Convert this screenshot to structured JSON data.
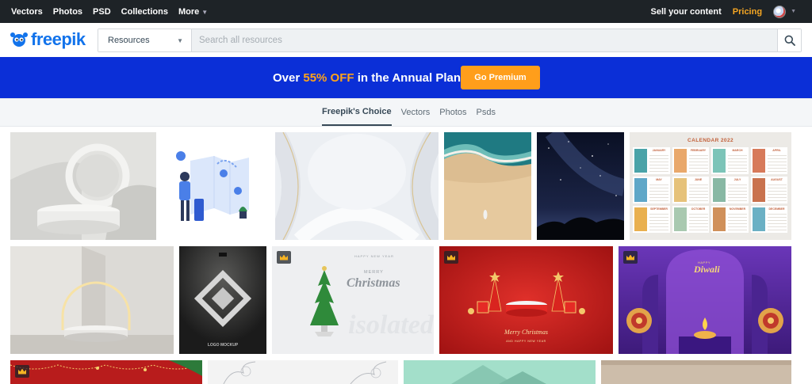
{
  "topbar": {
    "nav": [
      "Vectors",
      "Photos",
      "PSD",
      "Collections",
      "More"
    ],
    "sell": "Sell your content",
    "pricing": "Pricing"
  },
  "brand": {
    "name": "freepik"
  },
  "search": {
    "category": "Resources",
    "placeholder": "Search all resources"
  },
  "promo": {
    "prefix": "Over ",
    "highlight": "55% OFF",
    "suffix": " in the Annual Plan",
    "cta": "Go Premium"
  },
  "tabs": [
    "Freepik's Choice",
    "Vectors",
    "Photos",
    "Psds"
  ],
  "active_tab": 0,
  "calendar": {
    "title": "CALENDAR 2022",
    "months": [
      "JANUARY",
      "FEBRUARY",
      "MARCH",
      "APRIL",
      "MAY",
      "JUNE",
      "JULY",
      "AUGUST",
      "SEPTEMBER",
      "OCTOBER",
      "NOVEMBER",
      "DECEMBER"
    ]
  },
  "mockup_caption": "LOGO MOCKUP",
  "xmas_card": {
    "small": "HAPPY NEW YEAR",
    "merry": "MERRY",
    "title": "Christmas"
  },
  "red_card": {
    "title": "Merry Christmas",
    "sub": "AND HAPPY NEW YEAR"
  },
  "diwali": {
    "small": "HAPPY",
    "title": "Diwali"
  },
  "colors": {
    "accent": "#1273eb",
    "promo_bg": "#0b2fd7",
    "cta": "#ff9e1b",
    "topbar": "#1e2327"
  }
}
